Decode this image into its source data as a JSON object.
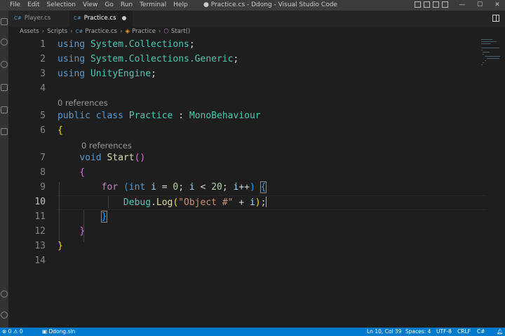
{
  "titlebar": {
    "menu": [
      "File",
      "Edit",
      "Selection",
      "View",
      "Go",
      "Run",
      "Terminal",
      "Help"
    ],
    "window_title": "● Practice.cs - Ddong - Visual Studio Code",
    "minimize": "—",
    "maximize": "☐",
    "close": "✕"
  },
  "activity_bar": {
    "icons": [
      "explorer-icon",
      "search-icon",
      "source-control-icon",
      "run-debug-icon",
      "extensions-icon",
      "remote-explorer-icon",
      "account-icon",
      "manage-gear-icon"
    ]
  },
  "tabs": [
    {
      "icon": "C#",
      "label": "Player.cs",
      "active": false
    },
    {
      "icon": "C#",
      "label": "Practice.cs",
      "active": true,
      "modified": true
    }
  ],
  "breadcrumb": [
    "Assets",
    "Scripts",
    "Practice.cs",
    "Practice",
    "Start()"
  ],
  "editor": {
    "current_line": 10,
    "line_numbers": [
      "1",
      "2",
      "3",
      "4",
      "5",
      "6",
      "7",
      "8",
      "9",
      "10",
      "11",
      "12",
      "13",
      "14"
    ],
    "lines": {
      "l1": {
        "kw": "using",
        "ns": "System.Collections",
        "end": ";"
      },
      "l2": {
        "kw": "using",
        "ns": "System.Collections.Generic",
        "end": ";"
      },
      "l3": {
        "kw": "using",
        "ns": "UnityEngine",
        "end": ";"
      },
      "l5": {
        "kw1": "public",
        "kw2": "class",
        "name": "Practice",
        "colon": ":",
        "base": "MonoBehaviour"
      },
      "l6": {
        "brace": "{"
      },
      "l7": {
        "kw": "void",
        "fn": "Start",
        "paren": "()"
      },
      "l8": {
        "brace": "{"
      },
      "l9": {
        "kw": "for",
        "open": "(",
        "type": "int",
        "var1": "i",
        "eq": "=",
        "zero": "0",
        "semi1": ";",
        "var2": "i",
        "lt": "<",
        "twenty": "20",
        "semi2": ";",
        "var3": "i",
        "inc": "++",
        "close": ")",
        "brace": "{"
      },
      "l10": {
        "cls": "Debug",
        "dot": ".",
        "fn": "Log",
        "open": "(",
        "str": "\"Object #\"",
        "plus": "+",
        "var": "i",
        "close": ")",
        "end": ";"
      },
      "l11": {
        "brace": "}"
      },
      "l12": {
        "brace": "}"
      },
      "l13": {
        "brace": "}"
      }
    },
    "codelens": {
      "class_refs": "0 references",
      "method_refs": "0 references"
    }
  },
  "statusbar": {
    "problems": "⊗ 0 ⚠ 0",
    "solution": "Ddong.sln",
    "position": "Ln 10, Col 39",
    "spaces": "Spaces: 4",
    "encoding": "UTF-8",
    "eol": "CRLF",
    "language": "C#",
    "colors": {
      "background": "#007acc"
    }
  },
  "colors": {
    "editor_bg": "#1e1e1e",
    "keyword": "#569cd6",
    "type": "#4ec9b0",
    "function": "#dcdcaa",
    "variable": "#9cdcfe",
    "string": "#ce9178",
    "number": "#b5cea8",
    "control": "#c586c0"
  }
}
